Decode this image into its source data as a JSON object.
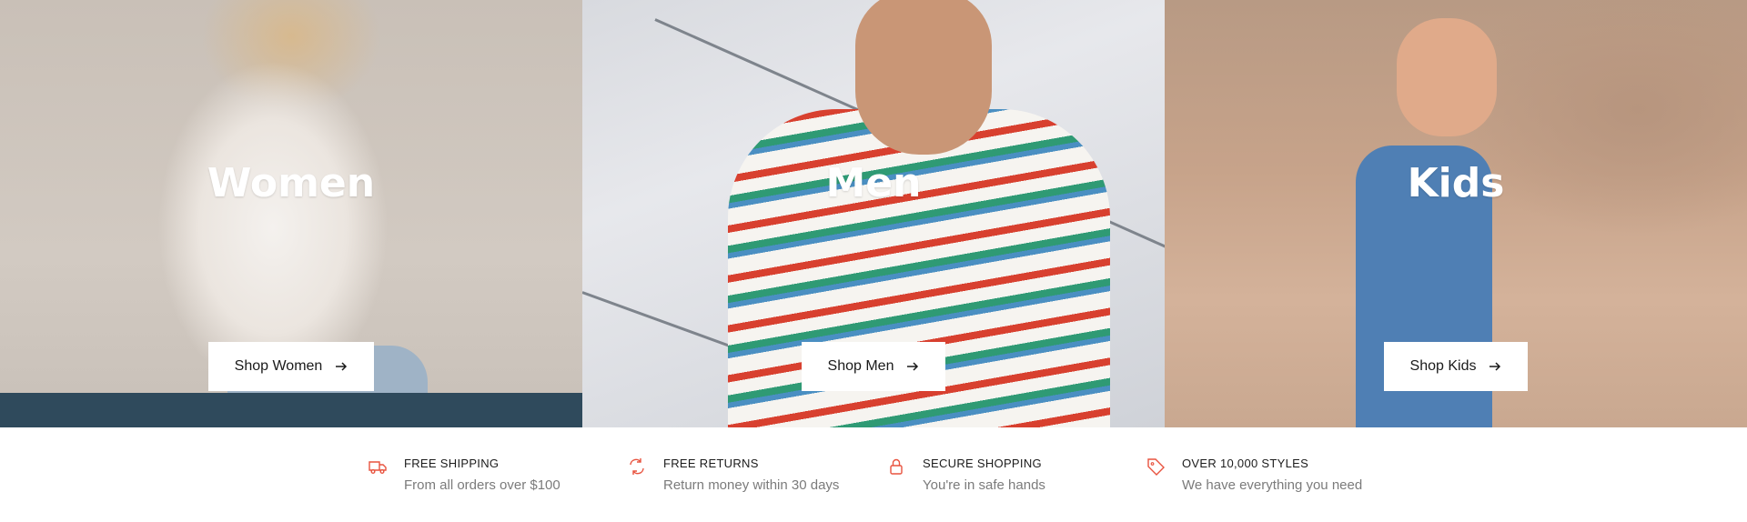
{
  "categories": [
    {
      "id": "women",
      "title": "Women",
      "button_label": "Shop Women"
    },
    {
      "id": "men",
      "title": "Men",
      "button_label": "Shop Men"
    },
    {
      "id": "kids",
      "title": "Kids",
      "button_label": "Shop Kids"
    }
  ],
  "features": [
    {
      "icon": "truck-icon",
      "title": "FREE SHIPPING",
      "description": "From all orders over $100"
    },
    {
      "icon": "returns-icon",
      "title": "FREE RETURNS",
      "description": "Return money within 30 days"
    },
    {
      "icon": "lock-icon",
      "title": "SECURE SHOPPING",
      "description": "You're in safe hands"
    },
    {
      "icon": "tag-icon",
      "title": "OVER 10,000 STYLES",
      "description": "We have everything you need"
    }
  ],
  "colors": {
    "accent": "#e8533f",
    "button_bg": "#ffffff",
    "text_dark": "#1c1c1c",
    "text_muted": "#7b7b7b"
  }
}
